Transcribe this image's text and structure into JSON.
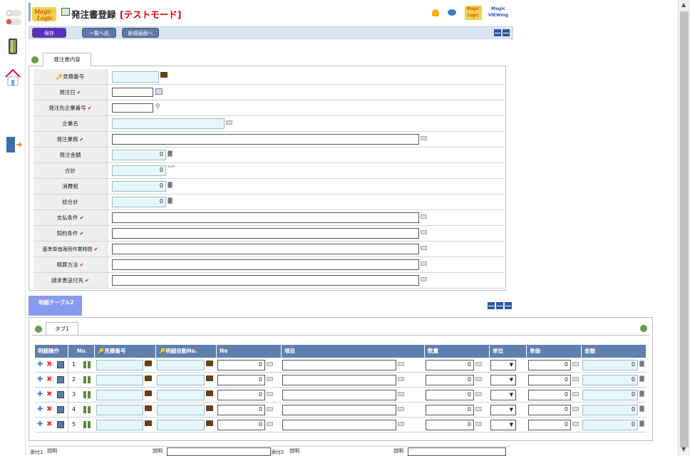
{
  "header": {
    "title": "発注書登録",
    "test_mode": "[テストモード]",
    "logo_text": "Magic Logic",
    "logo2_text": "Magic VIEWing"
  },
  "toolbar": {
    "save": "保存",
    "back_to_list": "一覧へ戻る",
    "new_screen": "新規画面へ"
  },
  "tabs": {
    "main_tab": "発注書内容",
    "detail_header": "明細テーブル2",
    "tab1": "タブ1"
  },
  "form": {
    "estimate_no": "見積番号",
    "order_date": "発注日",
    "supplier_code": "発注先企業番号",
    "company_name": "企業名",
    "order_work": "発注業務",
    "order_amount": "発注金額",
    "order_amount_value": "0",
    "total": "合計",
    "total_value": "0",
    "total_unit": "sum",
    "tax": "消費税",
    "tax_value": "0",
    "grand_total": "総合計",
    "grand_total_value": "0",
    "payment_terms": "支払条件",
    "contract_terms": "契約条件",
    "standard_unit_time": "基準単価適用作業時間",
    "settlement_method": "精算方法",
    "invoice_to": "請求書送付先"
  },
  "table": {
    "columns": [
      "明細操作",
      "No.",
      "見積番号",
      "明細自動No.",
      "No",
      "項目",
      "数量",
      "単位",
      "単価",
      "金額"
    ],
    "rows": [
      {
        "no": "1",
        "no_value": "0",
        "qty": "0",
        "price": "0",
        "amount": "0"
      },
      {
        "no": "2",
        "no_value": "0",
        "qty": "0",
        "price": "0",
        "amount": "0"
      },
      {
        "no": "3",
        "no_value": "0",
        "qty": "0",
        "price": "0",
        "amount": "0"
      },
      {
        "no": "4",
        "no_value": "0",
        "qty": "0",
        "price": "0",
        "amount": "0"
      },
      {
        "no": "5",
        "no_value": "0",
        "qty": "0",
        "price": "0",
        "amount": "0"
      }
    ]
  },
  "footer": {
    "attach1": "添付1",
    "desc1": "説明",
    "desc1b": "説明",
    "attach2": "添付2",
    "desc2": "説明",
    "desc2b": "説明"
  },
  "colors": {
    "accent_purple": "#5a2fc2",
    "button_blue": "#5b79a8",
    "header_blue": "#5f7fae",
    "required_red": "#d00000",
    "readonly_bg": "#e6f6fb"
  }
}
